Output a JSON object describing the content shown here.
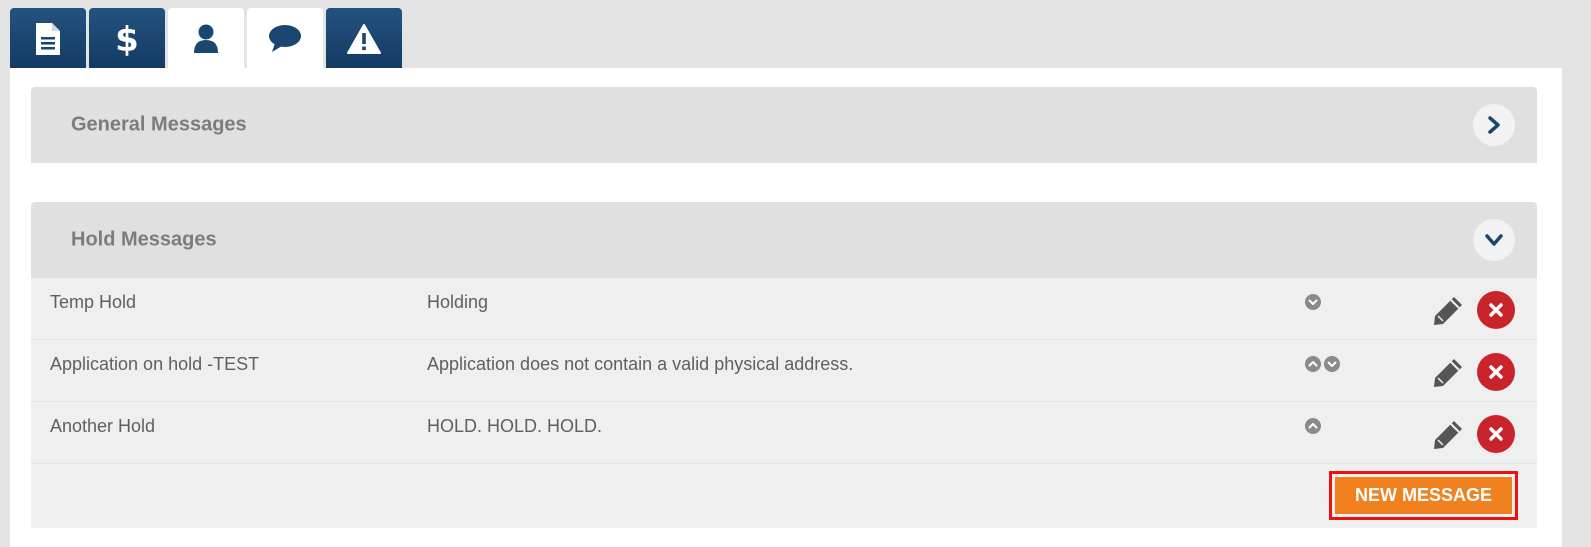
{
  "tabs": [
    {
      "icon": "document-icon",
      "active": false
    },
    {
      "icon": "dollar-icon",
      "active": false
    },
    {
      "icon": "user-icon",
      "active": true
    },
    {
      "icon": "comment-icon",
      "active": true
    },
    {
      "icon": "warning-icon",
      "active": false
    }
  ],
  "sections": {
    "general": {
      "title": "General Messages",
      "state": "collapsed",
      "toggle_icon": "chevron-right-icon"
    },
    "hold": {
      "title": "Hold Messages",
      "state": "expanded",
      "toggle_icon": "chevron-down-icon"
    }
  },
  "hold_messages": [
    {
      "name": "Temp Hold",
      "message": "Holding",
      "order_controls": [
        "down"
      ]
    },
    {
      "name": "Application on hold -TEST",
      "message": "Application does not contain a valid physical address.",
      "order_controls": [
        "up",
        "down"
      ]
    },
    {
      "name": "Another Hold",
      "message": "HOLD. HOLD. HOLD.",
      "order_controls": [
        "up"
      ]
    }
  ],
  "new_message_label": "NEW MESSAGE",
  "colors": {
    "tab_dark": "#1a4670",
    "accent_orange": "#f1811f",
    "delete_red": "#c9232b",
    "highlight_border": "#ee1111"
  }
}
